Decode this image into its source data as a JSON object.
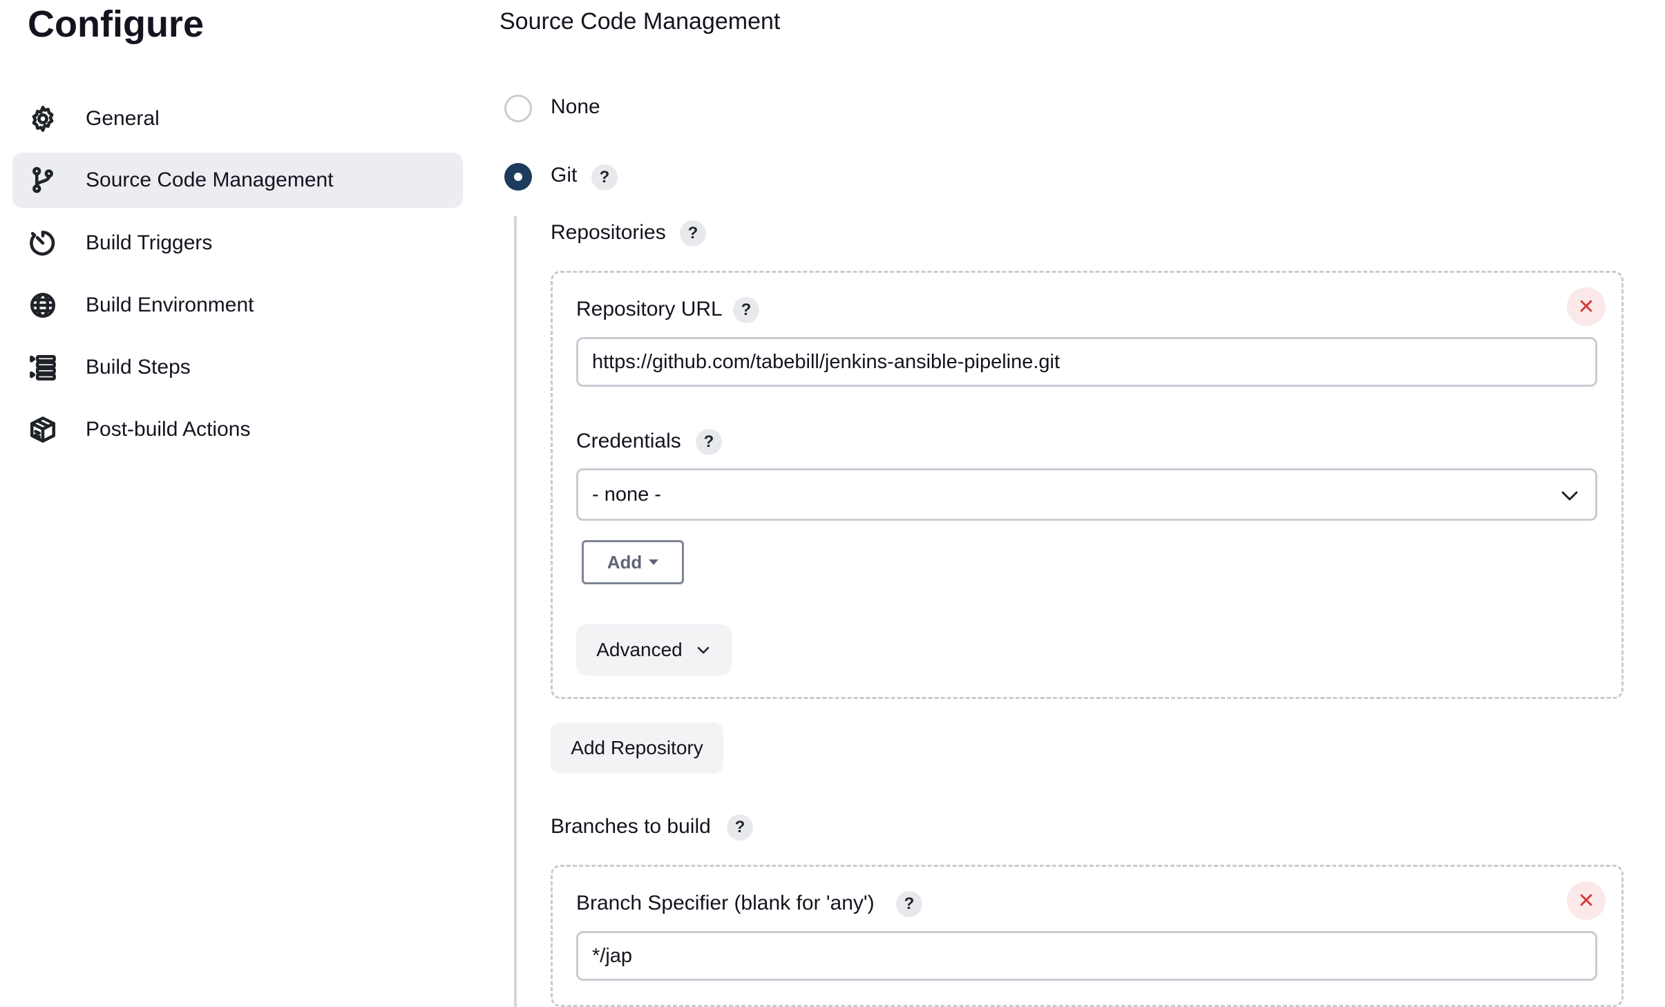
{
  "sidebar": {
    "title": "Configure",
    "items": [
      {
        "label": "General",
        "icon": "gear-icon"
      },
      {
        "label": "Source Code Management",
        "icon": "git-branch-icon"
      },
      {
        "label": "Build Triggers",
        "icon": "clock-icon"
      },
      {
        "label": "Build Environment",
        "icon": "globe-icon"
      },
      {
        "label": "Build Steps",
        "icon": "list-icon"
      },
      {
        "label": "Post-build Actions",
        "icon": "package-icon"
      }
    ],
    "active_index": 1
  },
  "main": {
    "section_title": "Source Code Management",
    "scm_options": {
      "none_label": "None",
      "git_label": "Git",
      "selected": "Git"
    },
    "help_glyph": "?",
    "repositories": {
      "label": "Repositories",
      "repository_url_label": "Repository URL",
      "repository_url_value": "https://github.com/tabebill/jenkins-ansible-pipeline.git",
      "credentials_label": "Credentials",
      "credentials_value": "- none -",
      "add_label": "Add",
      "advanced_label": "Advanced",
      "close_glyph": "✕"
    },
    "add_repository_label": "Add Repository",
    "branches": {
      "label": "Branches to build",
      "branch_specifier_label": "Branch Specifier (blank for 'any')",
      "branch_specifier_value": "*/jap",
      "close_glyph": "✕"
    }
  },
  "colors": {
    "radio_selected": "#1d3b5c",
    "sidebar_active_bg": "#ebedf1",
    "close_btn_bg": "#fbe9ea",
    "close_btn_fg": "#d33a3a"
  }
}
